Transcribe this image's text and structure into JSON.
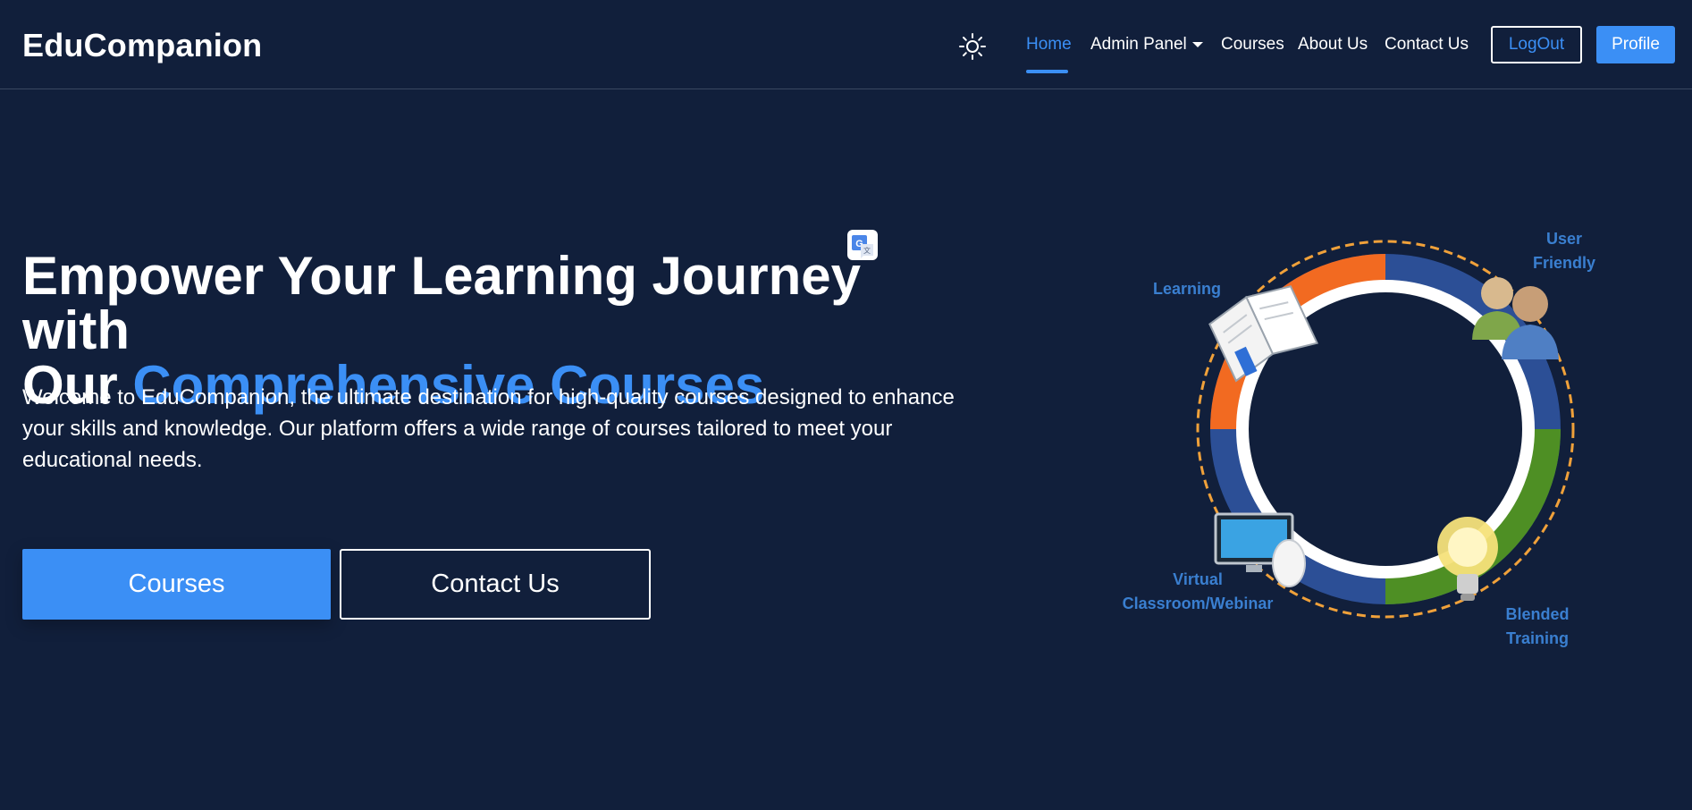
{
  "app": {
    "brand": "EduCompanion"
  },
  "nav": {
    "items": [
      {
        "label": "Home",
        "active": true
      },
      {
        "label": "Admin Panel",
        "has_dropdown": true
      },
      {
        "label": "Courses"
      },
      {
        "label": "About Us"
      },
      {
        "label": "Contact Us"
      }
    ],
    "logout_label": "LogOut",
    "profile_label": "Profile",
    "theme_icon": "sun-icon"
  },
  "hero": {
    "title_line1": "Empower Your Learning Journey with",
    "title_prefix": "Our ",
    "title_accent": "Comprehensive Courses",
    "description": "Welcome to EduCompanion, the ultimate destination for high-quality courses designed to enhance your skills and knowledge. Our platform offers a wide range of courses tailored to meet your educational needs.",
    "primary_button": "Courses",
    "secondary_button": "Contact Us"
  },
  "illustration": {
    "labels": {
      "learning": "Learning",
      "user_friendly_1": "User",
      "user_friendly_2": "Friendly",
      "virtual_1": "Virtual",
      "virtual_2": "Classroom/Webinar",
      "blended_1": "Blended",
      "blended_2": "Training"
    }
  },
  "colors": {
    "background": "#111f3b",
    "accent": "#3b8ff5",
    "text": "#ffffff",
    "ring_orange": "#f26a21",
    "ring_blue": "#2c4f96",
    "ring_green": "#4e8f24",
    "ring_dash": "#f0a13a",
    "illustration_label": "#3a7fd0"
  }
}
